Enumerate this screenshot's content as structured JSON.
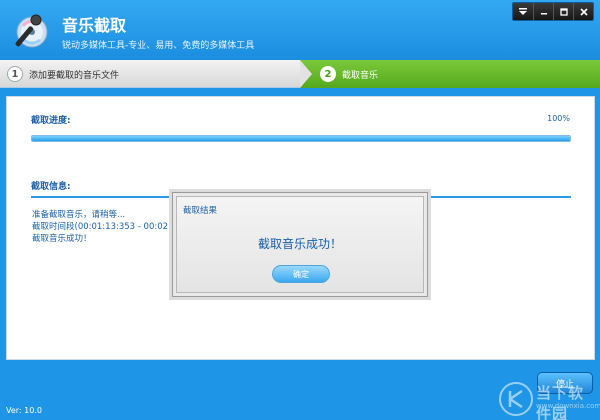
{
  "window": {
    "title": "音乐截取",
    "subtitle": "锐动多媒体工具-专业、易用、免费的多媒体工具",
    "controls": [
      "menu-icon",
      "minimize-icon",
      "maximize-icon",
      "close-icon"
    ]
  },
  "steps": [
    {
      "number": "1",
      "label": "添加要截取的音乐文件",
      "active": false
    },
    {
      "number": "2",
      "label": "截取音乐",
      "active": true
    }
  ],
  "progress": {
    "title": "截取进度:",
    "value_text": "100%",
    "fraction": 1.0
  },
  "info": {
    "title": "截取信息:",
    "lines": [
      "准备截取音乐，请稍等...",
      "截取时间段(00:01:13:353 - 00:02:0",
      "截取音乐成功！"
    ]
  },
  "dialog": {
    "title": "截取结果",
    "message": "截取音乐成功！",
    "ok_label": "确定"
  },
  "footer": {
    "stop_label": "停止",
    "version": "Ver: 10.0"
  },
  "watermark": {
    "text": "当下软件园",
    "sub": "www.downxia.com"
  },
  "colors": {
    "brand_blue": "#1e95e6",
    "step_active_green": "#6bbd2e",
    "text_blue": "#1a5fa8"
  }
}
